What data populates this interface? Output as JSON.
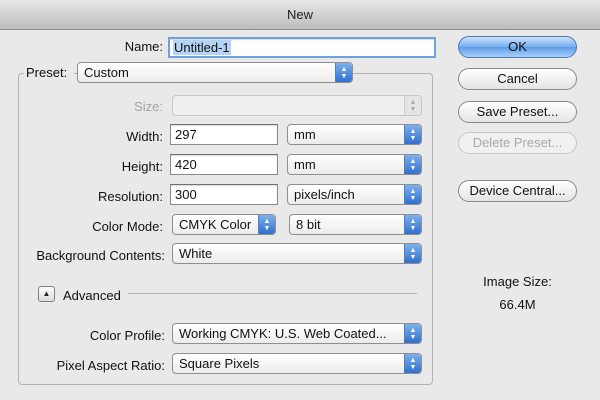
{
  "window": {
    "title": "New"
  },
  "name": {
    "label": "Name:",
    "value": "Untitled-1"
  },
  "preset": {
    "label": "Preset:",
    "value": "Custom"
  },
  "size": {
    "label": "Size:",
    "value": ""
  },
  "width": {
    "label": "Width:",
    "value": "297",
    "unit": "mm"
  },
  "height": {
    "label": "Height:",
    "value": "420",
    "unit": "mm"
  },
  "resolution": {
    "label": "Resolution:",
    "value": "300",
    "unit": "pixels/inch"
  },
  "color_mode": {
    "label": "Color Mode:",
    "mode": "CMYK Color",
    "depth": "8 bit"
  },
  "background": {
    "label": "Background Contents:",
    "value": "White"
  },
  "advanced": {
    "label": "Advanced",
    "toggle_glyph": "▲"
  },
  "color_profile": {
    "label": "Color Profile:",
    "value": "Working CMYK:  U.S. Web Coated..."
  },
  "pixel_aspect": {
    "label": "Pixel Aspect Ratio:",
    "value": "Square Pixels"
  },
  "buttons": {
    "ok": "OK",
    "cancel": "Cancel",
    "save_preset": "Save Preset...",
    "delete_preset": "Delete Preset...",
    "device_central": "Device Central..."
  },
  "image_size": {
    "label": "Image Size:",
    "value": "66.4M"
  },
  "icons": {
    "popup_arrows": "up-down-chevron-icon",
    "disclosure": "disclosure-triangle-icon"
  },
  "colors": {
    "accent": "#3f7fd6",
    "focus_ring": "#6ea2dd",
    "background": "#e9e9e9"
  }
}
